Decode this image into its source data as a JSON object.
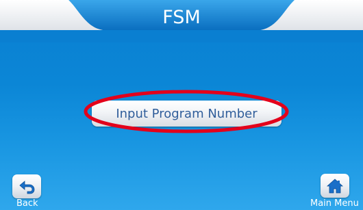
{
  "header": {
    "title": "FSM"
  },
  "main": {
    "program_button_label": "Input Program Number"
  },
  "footer": {
    "back_label": "Back",
    "main_menu_label": "Main Menu"
  },
  "icons": {
    "back": "back-arrow-icon",
    "home": "home-icon"
  },
  "colors": {
    "background_blue": "#0b86d6",
    "highlight_ring": "#e3001b",
    "button_text": "#2f5d9a",
    "title_text": "#ffffff"
  }
}
